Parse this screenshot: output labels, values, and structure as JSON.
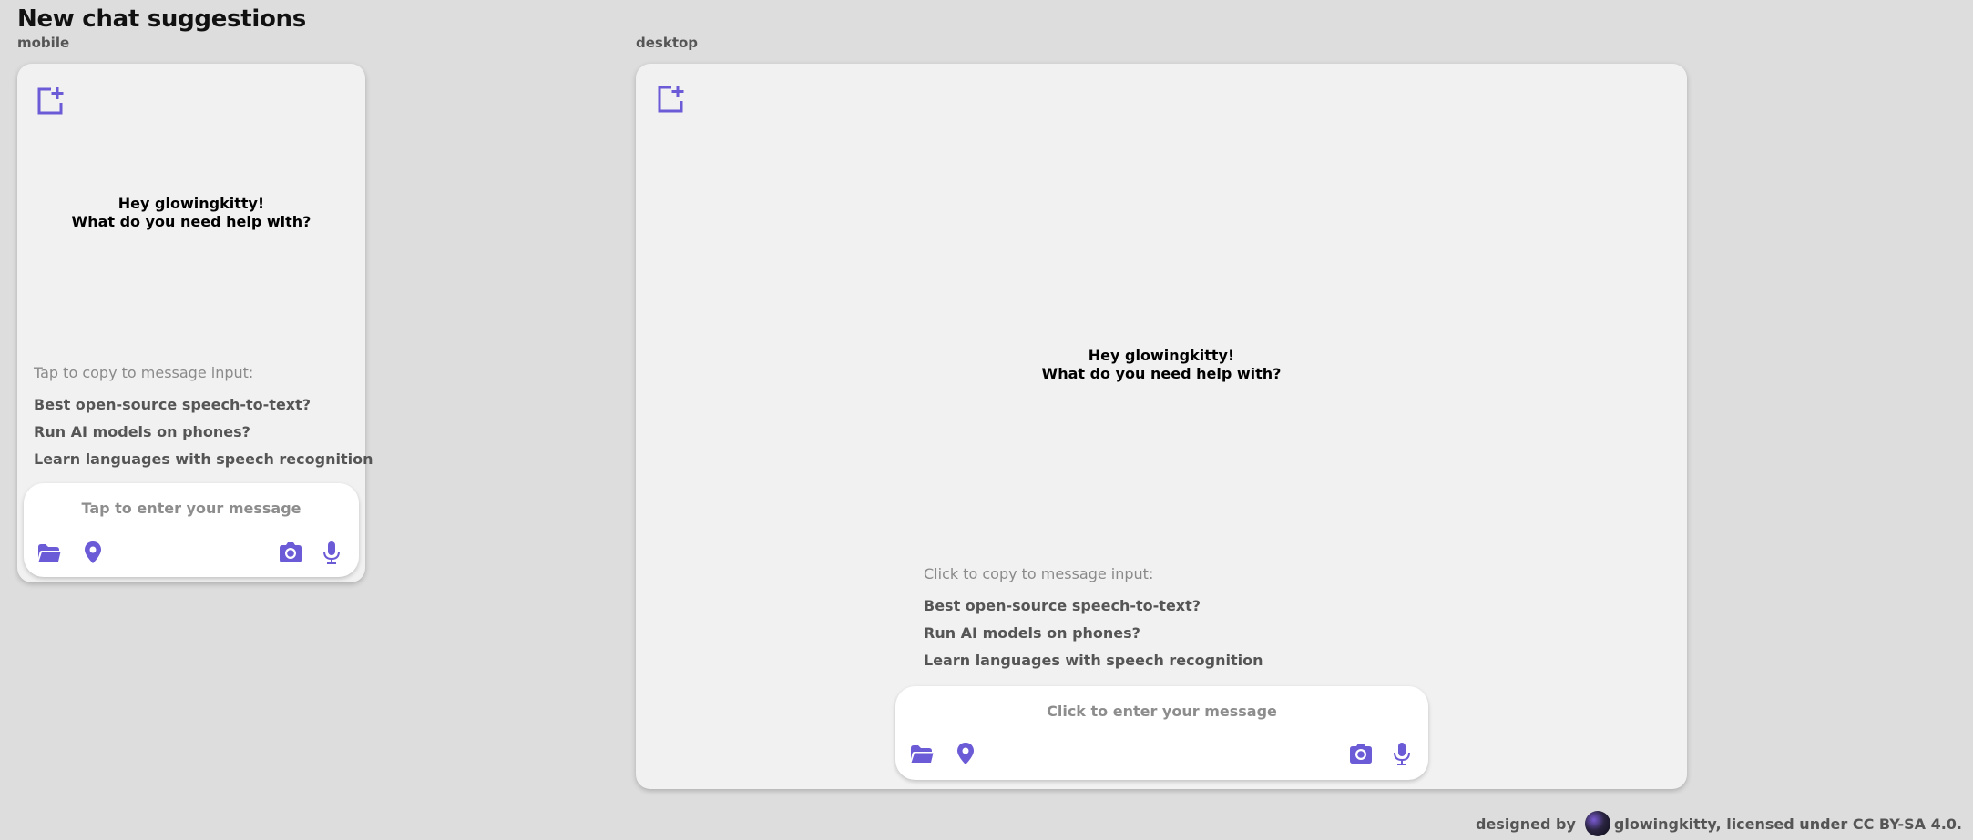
{
  "page": {
    "title": "New chat suggestions"
  },
  "mobile": {
    "section_label": "mobile",
    "greeting_line1": "Hey glowingkitty!",
    "greeting_line2": "What do you need help with?",
    "hint": "Tap to copy to message input:",
    "suggestions": [
      "Best open-source speech-to-text?",
      "Run AI models on phones?",
      "Learn languages with speech recognition"
    ],
    "input_placeholder": "Tap to enter your message"
  },
  "desktop": {
    "section_label": "desktop",
    "greeting_line1": "Hey glowingkitty!",
    "greeting_line2": "What do you need help with?",
    "hint": "Click to copy to message input:",
    "suggestions": [
      "Best open-source speech-to-text?",
      "Run AI models on phones?",
      "Learn languages with speech recognition"
    ],
    "input_placeholder": "Click to enter your message"
  },
  "footer": {
    "prefix": "designed by",
    "suffix": "glowingkitty, licensed under CC BY-SA 4.0."
  },
  "icons": {
    "new_chat": "new-chat-icon",
    "folder": "folder-icon",
    "location": "location-pin-icon",
    "camera": "camera-icon",
    "microphone": "microphone-icon"
  },
  "colors": {
    "accent": "#6b5bd6",
    "background": "#dddddd",
    "panel": "#f1f1f1"
  }
}
